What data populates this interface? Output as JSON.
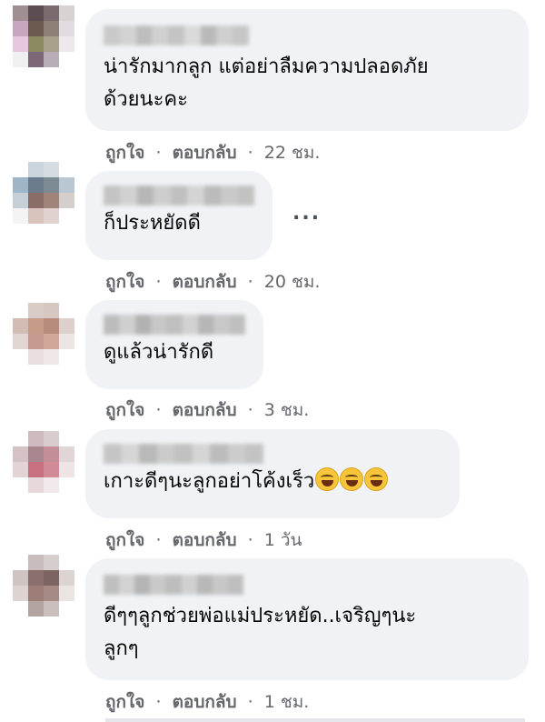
{
  "colors": {
    "bubble_bg": "#f0f2f5",
    "action_text": "#65676b",
    "comment_text": "#050505"
  },
  "comments": [
    {
      "text": "น่ารักมากลูก แต่อย่าลืมความปลอดภัย\nด้วยนะคะ",
      "like": "ถูกใจ",
      "reply": "ตอบกลับ",
      "time": "22 ชม."
    },
    {
      "text": "ก็ประหยัดดี",
      "like": "ถูกใจ",
      "reply": "ตอบกลับ",
      "time": "20 ชม."
    },
    {
      "text": "ดูแล้วน่ารักดี",
      "like": "ถูกใจ",
      "reply": "ตอบกลับ",
      "time": "3 ชม."
    },
    {
      "text": "เกาะดีๆนะลูกอย่าโค้งเร็ว",
      "emoji": [
        "rolling-laughing-emoji",
        "rolling-laughing-emoji",
        "rolling-laughing-emoji"
      ],
      "like": "ถูกใจ",
      "reply": "ตอบกลับ",
      "time": "1 วัน"
    },
    {
      "text": "ดีๆๆลูกช่วยพ่อแม่ประหยัด..เจริญๆนะ\nลูกๆ",
      "like": "ถูกใจ",
      "reply": "ตอบกลับ",
      "time": "1 ชม."
    }
  ],
  "more_options": "..."
}
